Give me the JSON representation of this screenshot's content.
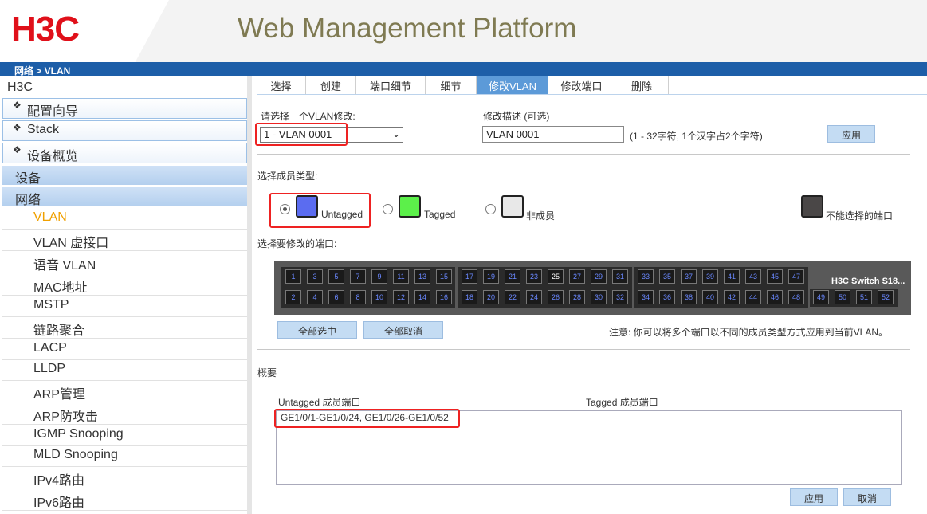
{
  "header": {
    "logo": "H3C",
    "title": "Web Management Platform",
    "breadcrumb": "网络 > VLAN"
  },
  "sidebar": {
    "root": "H3C",
    "boxes": [
      "配置向导",
      "Stack",
      "设备概览"
    ],
    "categories": [
      "设备",
      "网络"
    ],
    "items": [
      "VLAN",
      "VLAN 虚接口",
      "语音 VLAN",
      "MAC地址",
      "MSTP",
      "链路聚合",
      "LACP",
      "LLDP",
      "ARP管理",
      "ARP防攻击",
      "IGMP Snooping",
      "MLD Snooping",
      "IPv4路由",
      "IPv6路由"
    ],
    "active_item": "VLAN"
  },
  "tabs": [
    "选择",
    "创建",
    "端口细节",
    "细节",
    "修改VLAN",
    "修改端口",
    "删除"
  ],
  "active_tab": "修改VLAN",
  "form": {
    "select_label": "请选择一个VLAN修改:",
    "select_value": "1 - VLAN 0001",
    "desc_label": "修改描述  (可选)",
    "desc_value": "VLAN 0001",
    "desc_hint": "(1 - 32字符, 1个汉字占2个字符)",
    "apply": "应用"
  },
  "member_type": {
    "label": "选择成员类型:",
    "untagged": "Untagged",
    "tagged": "Tagged",
    "nonmember": "非成员",
    "unselectable": "不能选择的端口",
    "selected": "Untagged"
  },
  "ports": {
    "label": "选择要修改的端口:",
    "switch_name": "H3C Switch S18...",
    "top_row": [
      "1",
      "3",
      "5",
      "7",
      "9",
      "11",
      "13",
      "15",
      "17",
      "19",
      "21",
      "23",
      "25",
      "27",
      "29",
      "31",
      "33",
      "35",
      "37",
      "39",
      "41",
      "43",
      "45",
      "47"
    ],
    "bottom_row": [
      "2",
      "4",
      "6",
      "8",
      "10",
      "12",
      "14",
      "16",
      "18",
      "20",
      "22",
      "24",
      "26",
      "28",
      "30",
      "32",
      "34",
      "36",
      "38",
      "40",
      "42",
      "44",
      "46",
      "48"
    ],
    "uplinks": [
      "49",
      "50",
      "51",
      "52"
    ],
    "highlighted_port": "25",
    "select_all": "全部选中",
    "deselect_all": "全部取消",
    "note": "注意: 你可以将多个端口以不同的成员类型方式应用到当前VLAN。"
  },
  "summary": {
    "label": "概要",
    "untagged_header": "Untagged 成员端口",
    "tagged_header": "Tagged 成员端口",
    "untagged_ports": "GE1/0/1-GE1/0/24, GE1/0/26-GE1/0/52",
    "apply": "应用",
    "cancel": "取消"
  },
  "colors": {
    "untagged": "#5b6cf0",
    "tagged": "#5cf04a",
    "nonmember": "#e8e8e8",
    "unselectable": "#4a4747",
    "accent": "#1d5ea8",
    "highlight": "#e22222"
  }
}
